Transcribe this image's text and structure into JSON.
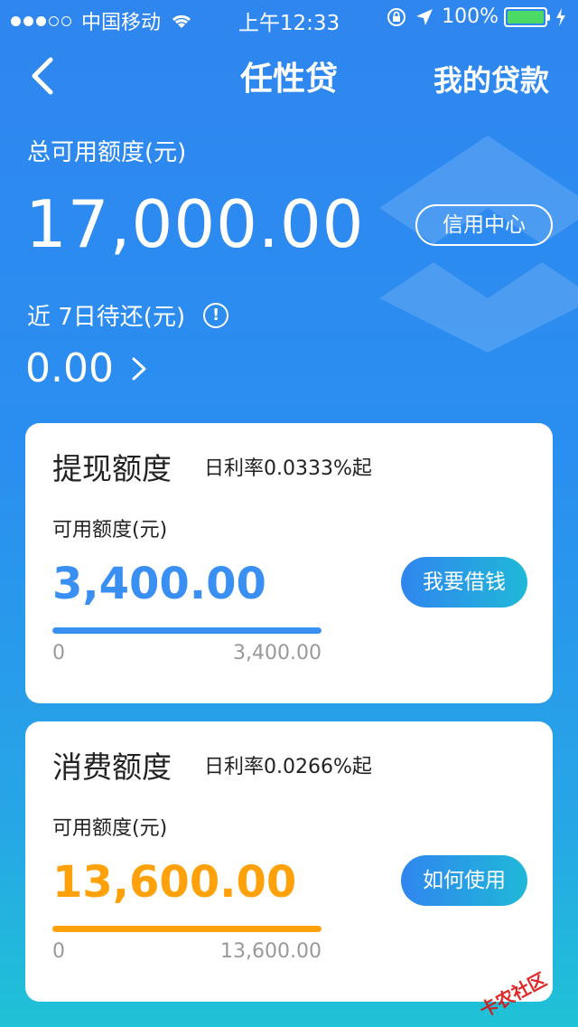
{
  "status_bar": {
    "carrier": "中国移动",
    "time": "上午12:33",
    "battery_text": "100%"
  },
  "nav": {
    "title": "任性贷",
    "right_link": "我的贷款"
  },
  "summary": {
    "total_label": "总可用额度(元)",
    "total_amount": "17,000.00",
    "credit_center": "信用中心",
    "due_label": "近 7日待还(元)",
    "info_mark": "!",
    "due_amount": "0.00"
  },
  "cards": [
    {
      "title": "提现额度",
      "rate": "日利率0.0333%起",
      "sub_label": "可用额度(元)",
      "amount": "3,400.00",
      "button": "我要借钱",
      "bar_min": "0",
      "bar_max": "3,400.00",
      "progress": 1.0,
      "accent": "#3a8ff3"
    },
    {
      "title": "消费额度",
      "rate": "日利率0.0266%起",
      "sub_label": "可用额度(元)",
      "amount": "13,600.00",
      "button": "如何使用",
      "bar_min": "0",
      "bar_max": "13,600.00",
      "progress": 1.0,
      "accent": "#ffa10a"
    }
  ],
  "watermark": "卡农社区"
}
